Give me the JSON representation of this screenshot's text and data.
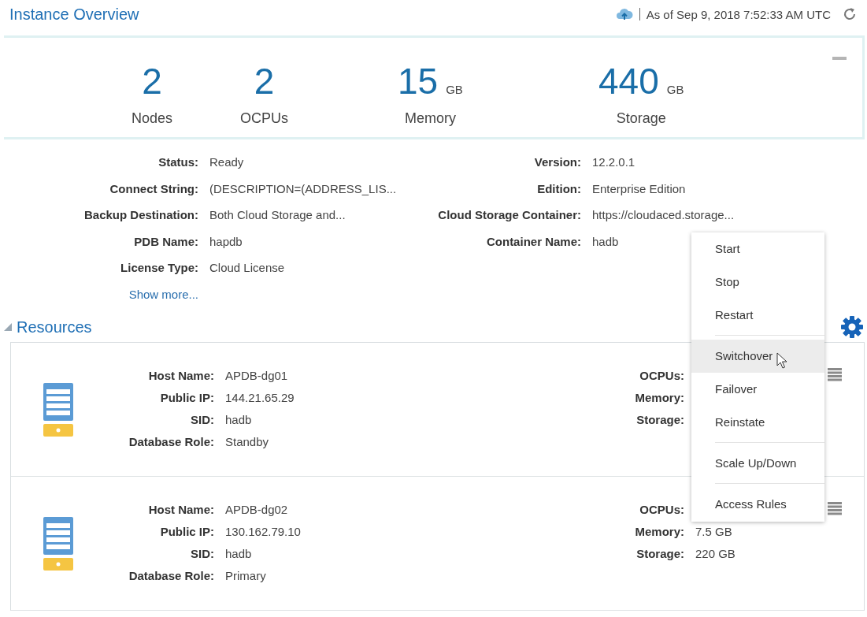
{
  "header": {
    "title": "Instance Overview",
    "timestamp": "As of Sep 9, 2018 7:52:33 AM UTC"
  },
  "metrics": [
    {
      "value": "2",
      "label": "Nodes"
    },
    {
      "value": "2",
      "label": "OCPUs"
    },
    {
      "value": "15",
      "unit": "GB",
      "label": "Memory"
    },
    {
      "value": "440",
      "unit": "GB",
      "label": "Storage"
    }
  ],
  "details": {
    "left": [
      {
        "label": "Status:",
        "value": "Ready"
      },
      {
        "label": "Connect String:",
        "value": "(DESCRIPTION=(ADDRESS_LIS..."
      },
      {
        "label": "Backup Destination:",
        "value": "Both Cloud Storage and..."
      },
      {
        "label": "PDB Name:",
        "value": "hapdb"
      },
      {
        "label": "License Type:",
        "value": "Cloud License"
      }
    ],
    "right": [
      {
        "label": "Version:",
        "value": "12.2.0.1"
      },
      {
        "label": "Edition:",
        "value": "Enterprise Edition"
      },
      {
        "label": "Cloud Storage Container:",
        "value": "https://cloudaced.storage..."
      },
      {
        "label": "Container Name:",
        "value": "hadb"
      }
    ],
    "show_more": "Show more..."
  },
  "resources": {
    "title": "Resources",
    "expanded": true,
    "nodes": [
      {
        "fields": [
          {
            "label": "Host Name:",
            "value": "APDB-dg01"
          },
          {
            "label": "Public IP:",
            "value": "144.21.65.29"
          },
          {
            "label": "SID:",
            "value": "hadb"
          },
          {
            "label": "Database Role:",
            "value": "Standby"
          }
        ],
        "stats": [
          {
            "label": "OCPUs:"
          },
          {
            "label": "Memory:"
          },
          {
            "label": "Storage:"
          }
        ]
      },
      {
        "fields": [
          {
            "label": "Host Name:",
            "value": "APDB-dg02"
          },
          {
            "label": "Public IP:",
            "value": "130.162.79.10"
          },
          {
            "label": "SID:",
            "value": "hadb"
          },
          {
            "label": "Database Role:",
            "value": "Primary"
          }
        ],
        "stats": [
          {
            "label": "OCPUs:"
          },
          {
            "label": "Memory:",
            "value": "7.5 GB"
          },
          {
            "label": "Storage:",
            "value": "220 GB"
          }
        ]
      }
    ]
  },
  "menu": [
    [
      {
        "label": "Start",
        "selected": false
      },
      {
        "label": "Stop",
        "selected": false
      },
      {
        "label": "Restart",
        "selected": false
      }
    ],
    [
      {
        "label": "Switchover",
        "selected": true
      },
      {
        "label": "Failover",
        "selected": false
      },
      {
        "label": "Reinstate",
        "selected": false
      }
    ],
    [
      {
        "label": "Scale Up/Down",
        "selected": false
      }
    ],
    [
      {
        "label": "Access Rules",
        "selected": false
      }
    ]
  ]
}
